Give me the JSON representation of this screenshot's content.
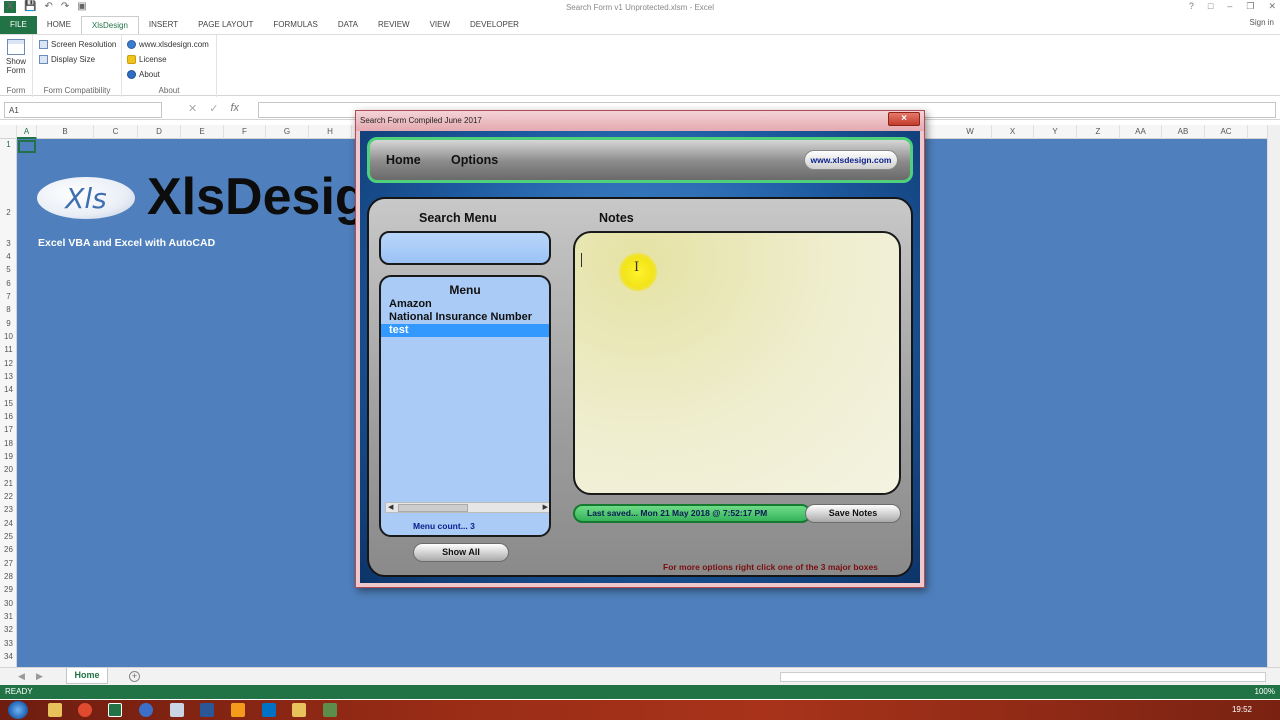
{
  "window": {
    "title": "Search Form v1 Unprotected.xlsm - Excel",
    "signin": "Sign in"
  },
  "ribbon": {
    "tabs": [
      "FILE",
      "HOME",
      "XlsDesign",
      "INSERT",
      "PAGE LAYOUT",
      "FORMULAS",
      "DATA",
      "REVIEW",
      "VIEW",
      "DEVELOPER"
    ],
    "active_tab": "XlsDesign",
    "groups": {
      "form": {
        "button": "Show\nForm",
        "button_line1": "Show",
        "button_line2": "Form",
        "label": "Form"
      },
      "compat": {
        "items": [
          "Screen Resolution",
          "Display Size"
        ],
        "label": "Form Compatibility"
      },
      "about": {
        "items": [
          "www.xlsdesign.com",
          "License",
          "About"
        ],
        "label": "About"
      }
    }
  },
  "formula_bar": {
    "name_box": "A1",
    "fx": "fx",
    "value": ""
  },
  "grid": {
    "columns": [
      "A",
      "B",
      "C",
      "D",
      "E",
      "F",
      "G",
      "H",
      "W",
      "X",
      "Y",
      "Z",
      "AA",
      "AB",
      "AC"
    ],
    "rows": [
      "1",
      "2",
      "3",
      "4",
      "5",
      "6",
      "7",
      "8",
      "9",
      "10",
      "11",
      "12",
      "13",
      "14",
      "15",
      "16",
      "17",
      "18",
      "19",
      "20",
      "21",
      "22",
      "23",
      "24",
      "25",
      "26",
      "27",
      "28",
      "29",
      "30",
      "31",
      "32",
      "33",
      "34"
    ],
    "sheet_bg": "#4f80bd"
  },
  "sheet_content": {
    "logo_text": "Xls",
    "brand": "XlsDesig",
    "tagline": "Excel VBA and Excel with AutoCAD"
  },
  "sheet_tabs": {
    "active": "Home"
  },
  "status": {
    "ready": "READY",
    "zoom": "100%"
  },
  "taskbar": {
    "time": "19:52"
  },
  "dialog": {
    "title": "Search Form Compiled June 2017",
    "close": "×",
    "nav": {
      "home": "Home",
      "options": "Options",
      "web": "www.xlsdesign.com"
    },
    "search_heading": "Search  Menu",
    "notes_heading": "Notes",
    "search_value": "",
    "menu": {
      "title": "Menu",
      "items": [
        "Amazon",
        "National Insurance Number",
        "test"
      ],
      "selected_index": 2,
      "count_label": "Menu count... 3"
    },
    "show_all": "Show All",
    "notes_value": "",
    "last_saved": "Last saved... Mon 21 May 2018 @ 7:52:17 PM",
    "save_notes": "Save Notes",
    "footnote": "For more options right click one of the 3 major boxes"
  },
  "colors": {
    "excel_green": "#217346",
    "nav_border": "#4ed07c",
    "menu_selected": "#3399ff",
    "footnote": "#7a0f10"
  }
}
